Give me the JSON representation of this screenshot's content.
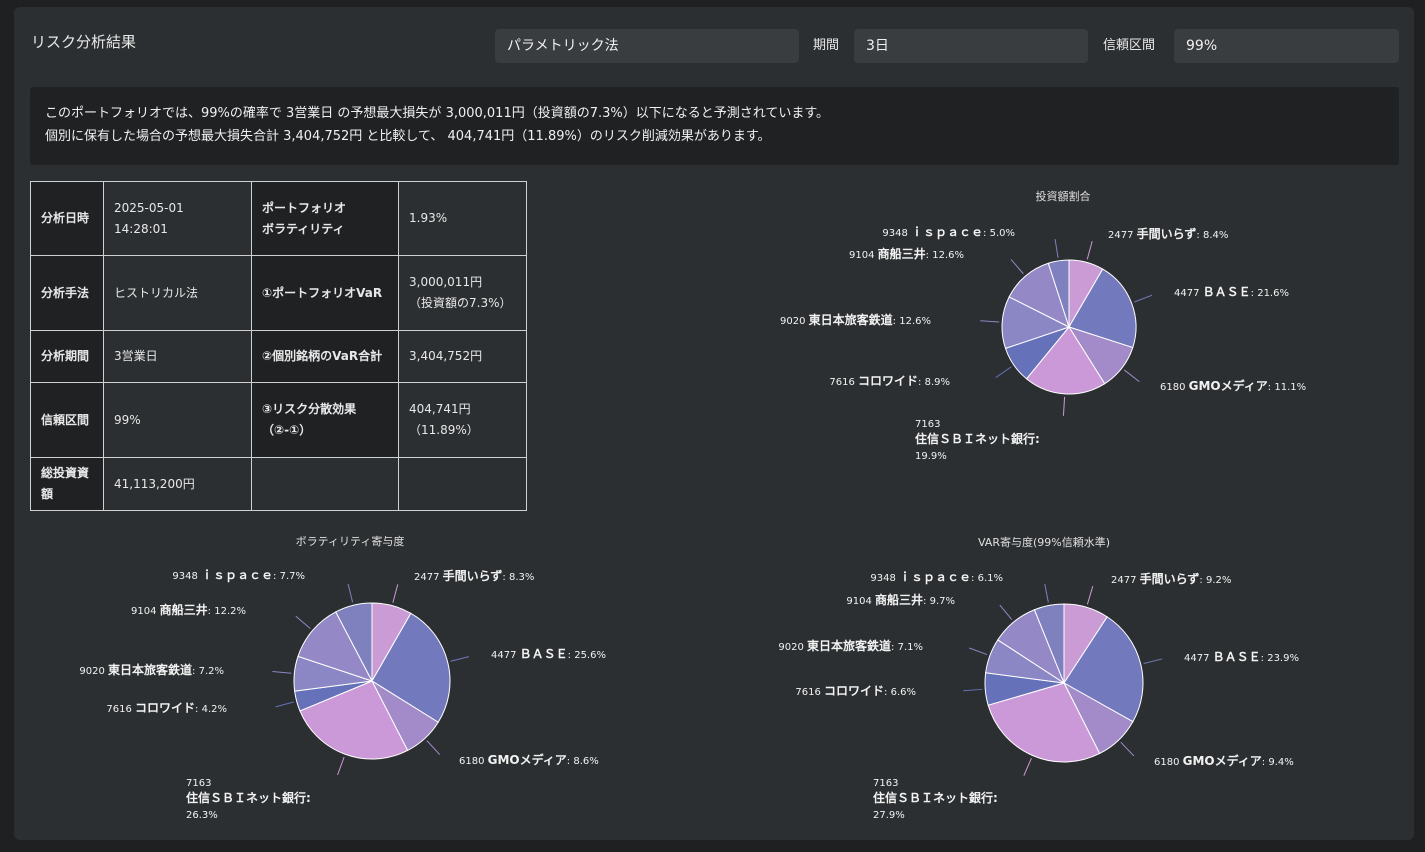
{
  "header": {
    "title": "リスク分析結果",
    "method_select": "パラメトリック法",
    "period_label": "期間",
    "period_value": "3日",
    "confidence_label": "信頼区間",
    "confidence_value": "99%"
  },
  "summary": {
    "line1": "このポートフォリオでは、99%の確率で 3営業日 の予想最大損失が 3,000,011円（投資額の7.3%）以下になると予測されています。",
    "line2": "個別に保有した場合の予想最大損失合計 3,404,752円 と比較して、 404,741円（11.89%）のリスク削減効果があります。"
  },
  "table": {
    "analysis_date_label": "分析日時",
    "analysis_date_value": "2025-05-01 14:28:01",
    "portfolio_vol_label_1": "ポートフォリオ",
    "portfolio_vol_label_2": "ボラティリティ",
    "portfolio_vol_value": "1.93%",
    "method_label": "分析手法",
    "method_value": "ヒストリカル法",
    "portfolio_var_label": "①ポートフォリオVaR",
    "portfolio_var_value_1": "3,000,011円",
    "portfolio_var_value_2": "（投資額の7.3%）",
    "period_label": "分析期間",
    "period_value": "3営業日",
    "sum_var_label": "②個別銘柄のVaR合計",
    "sum_var_value": "3,404,752円",
    "confidence_label": "信頼区間",
    "confidence_value": "99%",
    "diversification_label_1": "③リスク分散効果",
    "diversification_label_2": "（②-①）",
    "diversification_value_1": "404,741円",
    "diversification_value_2": "（11.89%）",
    "total_investment_label": "総投資資額",
    "total_investment_value": "41,113,200円"
  },
  "chart_data": [
    {
      "type": "pie",
      "title": "投資額割合",
      "categories": [
        {
          "code": "2477",
          "name": "手間いらず",
          "pct": "8.4%"
        },
        {
          "code": "4477",
          "name": "ＢＡＳＥ",
          "pct": "21.6%"
        },
        {
          "code": "6180",
          "name": "GMOメディア",
          "pct": "11.1%"
        },
        {
          "code": "7163",
          "name": "住信ＳＢＩネット銀行",
          "pct": "19.9%"
        },
        {
          "code": "7616",
          "name": "コロワイド",
          "pct": "8.9%"
        },
        {
          "code": "9020",
          "name": "東日本旅客鉄道",
          "pct": "12.6%"
        },
        {
          "code": "9104",
          "name": "商船三井",
          "pct": "12.6%"
        },
        {
          "code": "9348",
          "name": "ｉｓｐａｃｅ",
          "pct": "5.0%"
        }
      ],
      "values": [
        8.4,
        21.6,
        11.1,
        19.9,
        8.9,
        12.6,
        12.6,
        5.0
      ]
    },
    {
      "type": "pie",
      "title": "ボラティリティ寄与度",
      "categories": [
        {
          "code": "2477",
          "name": "手間いらず",
          "pct": "8.3%"
        },
        {
          "code": "4477",
          "name": "ＢＡＳＥ",
          "pct": "25.6%"
        },
        {
          "code": "6180",
          "name": "GMOメディア",
          "pct": "8.6%"
        },
        {
          "code": "7163",
          "name": "住信ＳＢＩネット銀行",
          "pct": "26.3%"
        },
        {
          "code": "7616",
          "name": "コロワイド",
          "pct": "4.2%"
        },
        {
          "code": "9020",
          "name": "東日本旅客鉄道",
          "pct": "7.2%"
        },
        {
          "code": "9104",
          "name": "商船三井",
          "pct": "12.2%"
        },
        {
          "code": "9348",
          "name": "ｉｓｐａｃｅ",
          "pct": "7.7%"
        }
      ],
      "values": [
        8.3,
        25.6,
        8.6,
        26.3,
        4.2,
        7.2,
        12.2,
        7.7
      ]
    },
    {
      "type": "pie",
      "title": "VAR寄与度(99%信頼水準)",
      "categories": [
        {
          "code": "2477",
          "name": "手間いらず",
          "pct": "9.2%"
        },
        {
          "code": "4477",
          "name": "ＢＡＳＥ",
          "pct": "23.9%"
        },
        {
          "code": "6180",
          "name": "GMOメディア",
          "pct": "9.4%"
        },
        {
          "code": "7163",
          "name": "住信ＳＢＩネット銀行",
          "pct": "27.9%"
        },
        {
          "code": "7616",
          "name": "コロワイド",
          "pct": "6.6%"
        },
        {
          "code": "9020",
          "name": "東日本旅客鉄道",
          "pct": "7.1%"
        },
        {
          "code": "9104",
          "name": "商船三井",
          "pct": "9.7%"
        },
        {
          "code": "9348",
          "name": "ｉｓｐａｃｅ",
          "pct": "6.1%"
        }
      ],
      "values": [
        9.2,
        23.9,
        9.4,
        27.9,
        6.6,
        7.1,
        9.7,
        6.1
      ]
    }
  ],
  "colors": [
    "#cb9bd6",
    "#7279bc",
    "#a28bc8",
    "#cc99d8",
    "#6571b8",
    "#8b86c4",
    "#9488c6",
    "#7f81bf"
  ]
}
